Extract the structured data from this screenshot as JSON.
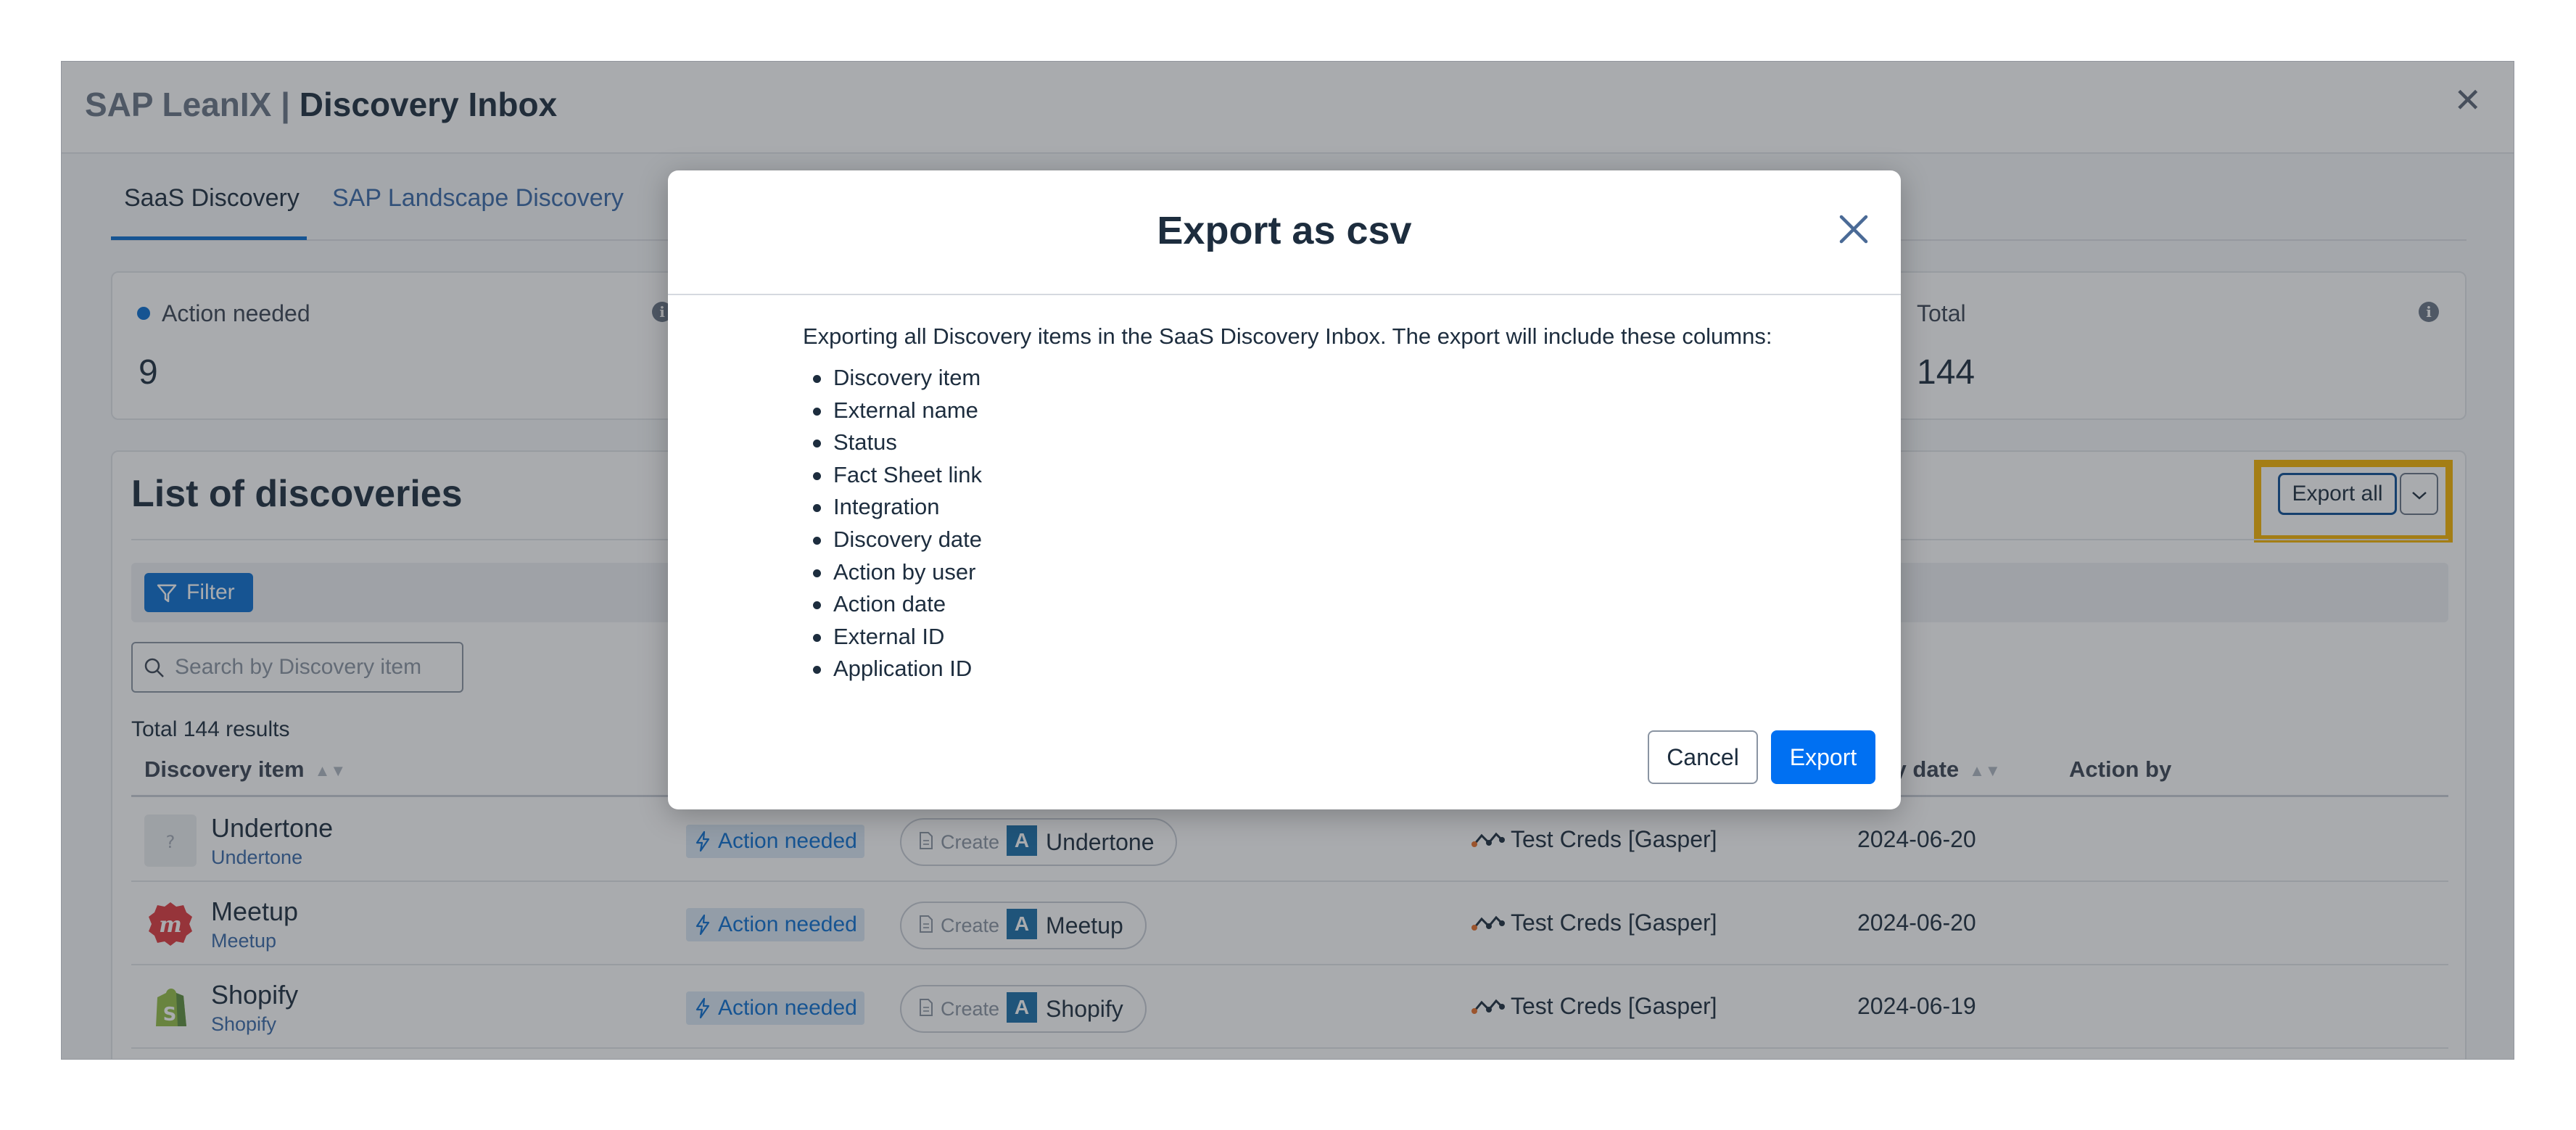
{
  "window": {
    "title_brand": "SAP LeanIX | ",
    "title_page": "Discovery Inbox",
    "close_icon": "close-icon"
  },
  "tabs": [
    {
      "label": "SaaS Discovery",
      "active": true
    },
    {
      "label": "SAP Landscape Discovery",
      "active": false
    }
  ],
  "stats": {
    "action_needed": {
      "label": "Action needed",
      "value": "9",
      "dot_color": "#0a6ed1"
    },
    "total": {
      "label": "Total",
      "value": "144"
    }
  },
  "list": {
    "title": "List of discoveries",
    "export_all_label": "Export all",
    "highlight_color": "#f7b500",
    "filter_label": "Filter",
    "search_placeholder": "Search by Discovery item",
    "results_text": "Total 144 results",
    "columns": {
      "discovery_item": "Discovery item",
      "discovery_date": "very date",
      "action_by": "Action by"
    },
    "rows": [
      {
        "name": "Undertone",
        "sub": "Undertone",
        "status": "Action needed",
        "create_label": "Create",
        "create_badge": "A",
        "create_name": "Undertone",
        "integration": "Test Creds [Gasper]",
        "date": "2024-06-20",
        "icon": "placeholder-app-icon"
      },
      {
        "name": "Meetup",
        "sub": "Meetup",
        "status": "Action needed",
        "create_label": "Create",
        "create_badge": "A",
        "create_name": "Meetup",
        "integration": "Test Creds [Gasper]",
        "date": "2024-06-20",
        "icon": "meetup-logo-icon"
      },
      {
        "name": "Shopify",
        "sub": "Shopify",
        "status": "Action needed",
        "create_label": "Create",
        "create_badge": "A",
        "create_name": "Shopify",
        "integration": "Test Creds [Gasper]",
        "date": "2024-06-19",
        "icon": "shopify-logo-icon"
      }
    ]
  },
  "dialog": {
    "title": "Export as csv",
    "intro": "Exporting all Discovery items in the SaaS Discovery Inbox. The export will include these columns:",
    "columns": [
      "Discovery item",
      "External name",
      "Status",
      "Fact Sheet link",
      "Integration",
      "Discovery date",
      "Action by user",
      "Action date",
      "External ID",
      "Application ID"
    ],
    "cancel_label": "Cancel",
    "export_label": "Export",
    "export_color": "#0070f2"
  }
}
